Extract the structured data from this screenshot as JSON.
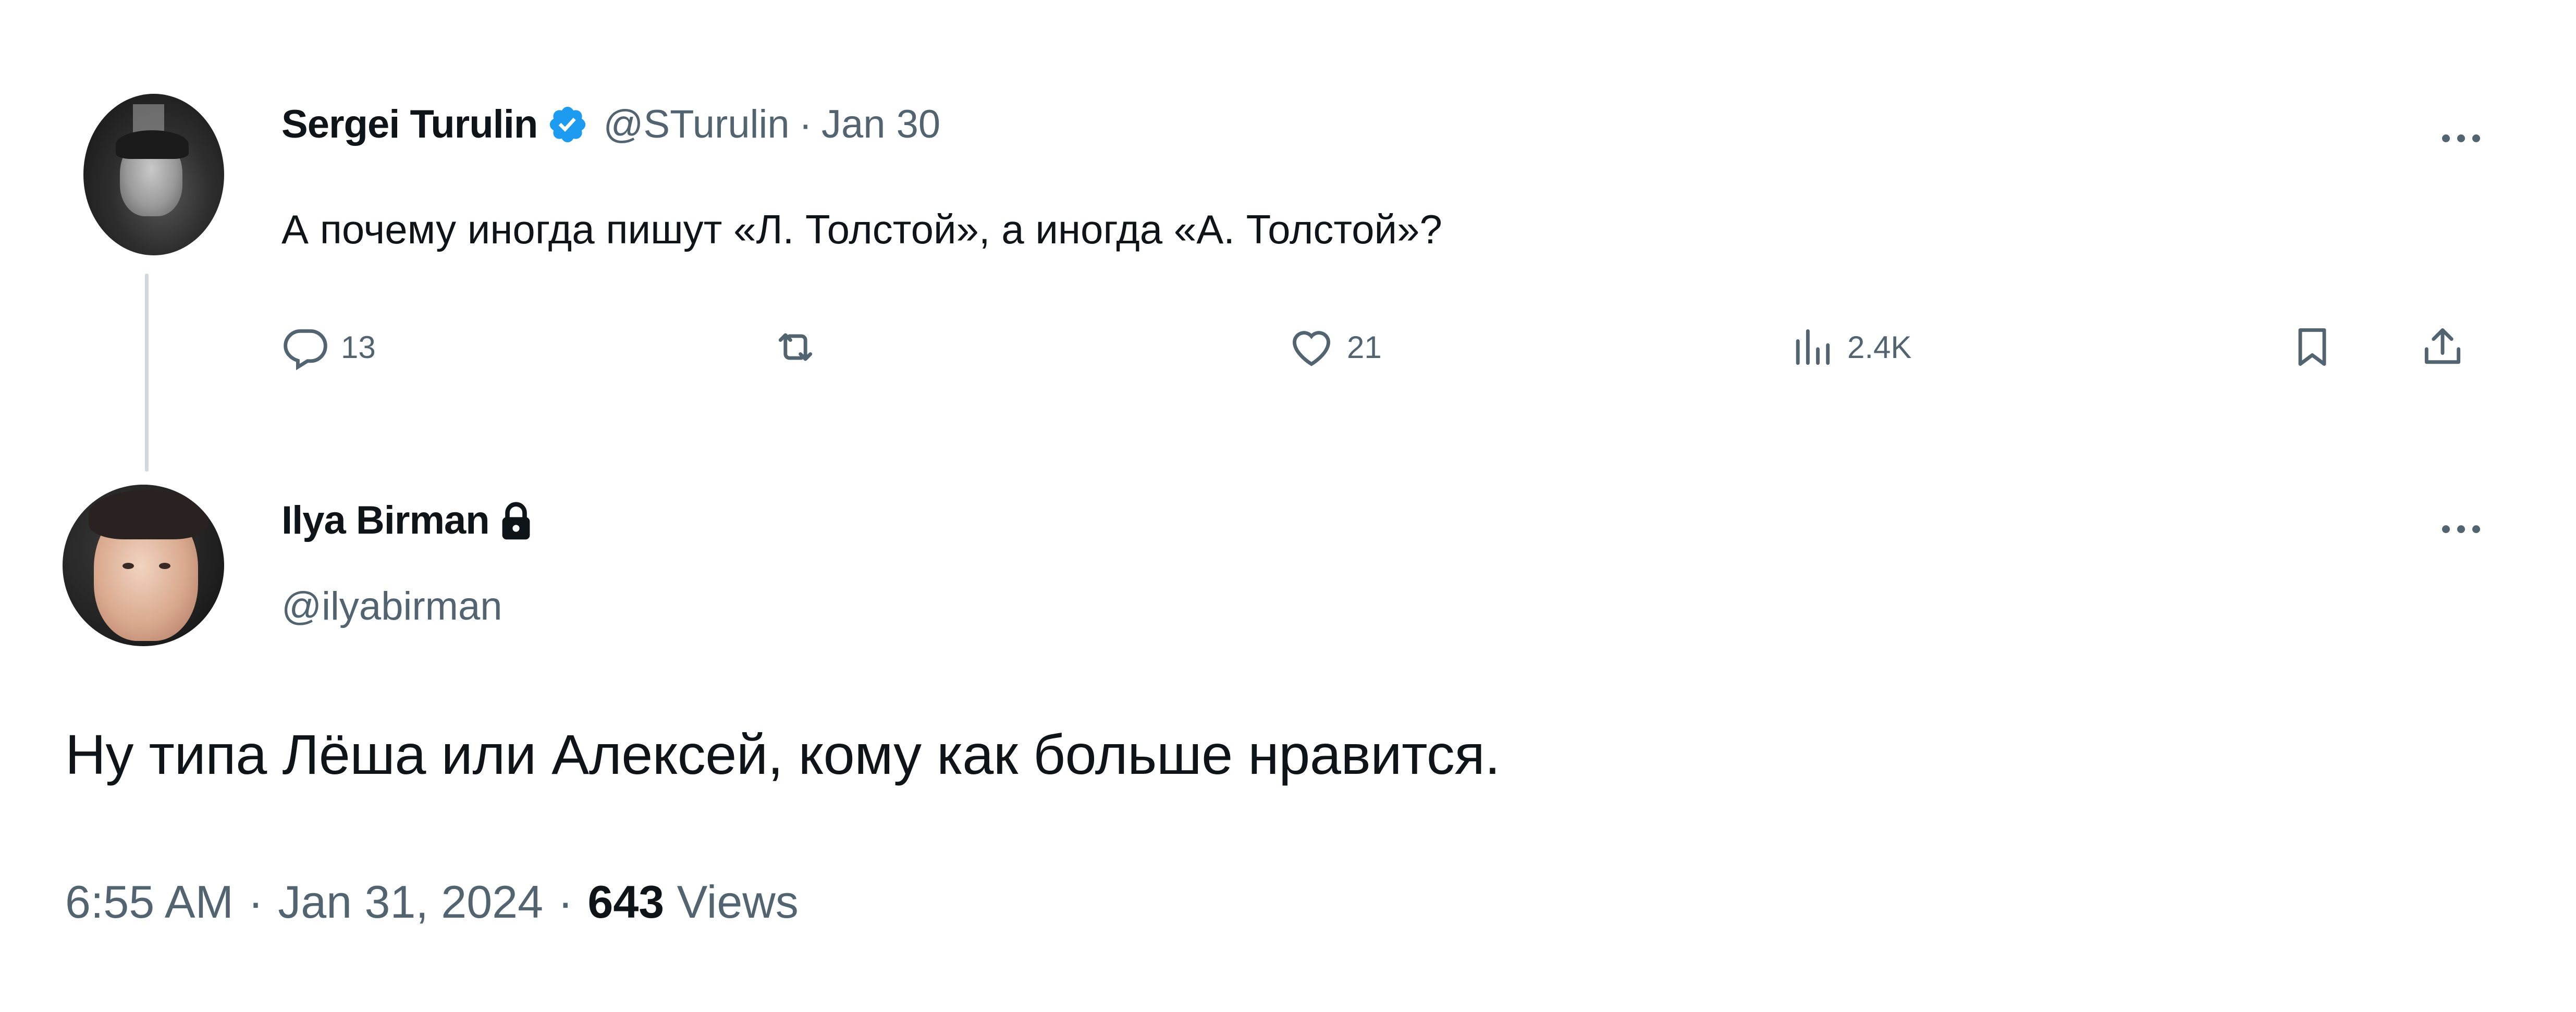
{
  "parent_tweet": {
    "author_name": "Sergei Turulin",
    "verified_icon": "verified-badge-icon",
    "handle": "@STurulin",
    "separator": "·",
    "date": "Jan 30",
    "text": "А почему иногда пишут «Л. Толстой», а иногда «А. Толстой»?",
    "actions": {
      "replies": "13",
      "reposts": "",
      "likes": "21",
      "views": "2.4K"
    }
  },
  "reply_tweet": {
    "author_name": "Ilya Birman",
    "lock_icon": "lock-icon",
    "handle": "@ilyabirman",
    "text": "Ну типа Лёша или Алексей, кому как больше нравится.",
    "time": "6:55 AM",
    "separator": "·",
    "date": "Jan 31, 2024",
    "views_count": "643",
    "views_label": "Views"
  },
  "colors": {
    "text": "#0f1419",
    "muted": "#536471",
    "verified": "#1d9bf0",
    "thread_line": "#cfd9de"
  }
}
